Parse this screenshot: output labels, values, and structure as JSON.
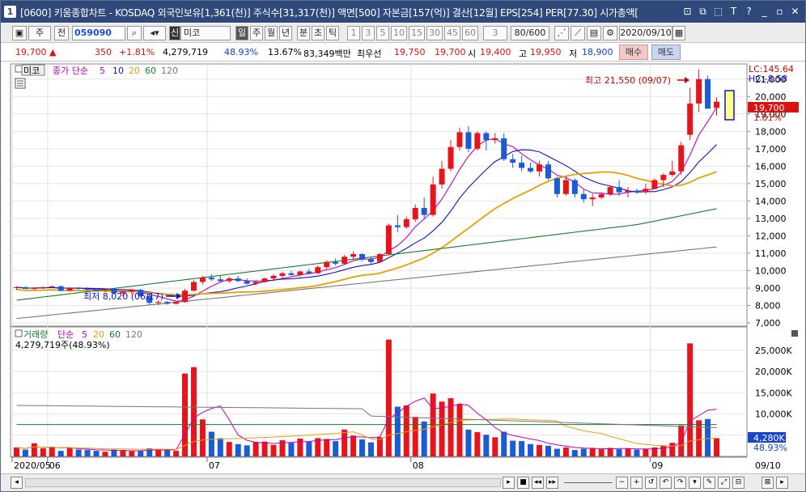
{
  "window": {
    "number": "1",
    "title": "[0600] 키움종합차트 - KOSDAQ 외국인보유[1,361(천)] 주식수[31,317(천)] 액면[500] 자본금[157(억)] 결산[12월] EPS[254] PER[77.30] 시가총액[",
    "buttons": [
      "⊡",
      "⧉",
      "⬚",
      "T",
      "?",
      "_",
      "▫",
      "✕"
    ]
  },
  "toolbar": {
    "period_label": "주",
    "prev_label": "전",
    "code": "059090",
    "new_badge": "신",
    "name": "미코",
    "tabs": [
      "일",
      "주",
      "월",
      "년",
      "분",
      "초",
      "틱"
    ],
    "intervals": [
      "1",
      "3",
      "5",
      "10",
      "15",
      "30",
      "45",
      "60"
    ],
    "custom": "3",
    "count": "80/600",
    "date": "2020/09/10"
  },
  "price": {
    "current": "19,700 ▲",
    "change": "350",
    "change_pct": "+1.81%",
    "volume": "4,279,719",
    "vol_ratio": "48.93%",
    "turnover": "13.67%",
    "amount": "83,349백만",
    "best_ask_label": "최우선",
    "best_ask": "19,750",
    "best_bid": "19,700",
    "open_label": "시",
    "open": "19,400",
    "high_label": "고",
    "high": "19,950",
    "low_label": "저",
    "low": "18,900",
    "buy": "매수",
    "sell": "매도"
  },
  "price_panel": {
    "name_tag": "미코",
    "legend_title": "종가 단순",
    "ma_labels": [
      "5",
      "10",
      "20",
      "60",
      "120"
    ],
    "ma_colors": [
      "#c000c0",
      "#1010d0",
      "#e8a000",
      "#1a7a2a",
      "#777777"
    ],
    "lc": "LC:145.64",
    "hc": "HC:-8.58",
    "current_tag": "19,700",
    "pct_tag": "1.81%",
    "high_note": "최고 21,550 (09/07)",
    "low_note": "최저 8,020 (06/17)",
    "y_labels": [
      "21,000",
      "20,000",
      "19,000",
      "18,000",
      "17,000",
      "16,000",
      "15,000",
      "14,000",
      "13,000",
      "12,000",
      "11,000",
      "10,000",
      "9,000",
      "8,000",
      "7,000"
    ]
  },
  "volume_panel": {
    "legend_title": "거래량",
    "legend_ma": "단순",
    "ma_labels": [
      "5",
      "20",
      "60",
      "120"
    ],
    "info": "4,279,719주(48.93%)",
    "y_labels": [
      "25,000K",
      "20,000K",
      "15,000K",
      "10,000K",
      "5,000K"
    ],
    "current_tag": "4,280K",
    "pct_tag": "48.93%"
  },
  "x_axis": {
    "labels": [
      "2020/05",
      "06",
      "07",
      "08",
      "09"
    ],
    "end_label": "09/10"
  },
  "chart_data": {
    "type": "candlestick",
    "ohlc": [
      [
        9000,
        9100,
        8900,
        9050
      ],
      [
        9050,
        9100,
        8950,
        8950
      ],
      [
        8950,
        9050,
        8900,
        9000
      ],
      [
        9000,
        9100,
        8950,
        9050
      ],
      [
        9050,
        9150,
        9000,
        9100
      ],
      [
        9100,
        9150,
        8800,
        8850
      ],
      [
        8850,
        9050,
        8800,
        9000
      ],
      [
        9000,
        9050,
        8900,
        8950
      ],
      [
        8950,
        9050,
        8850,
        8900
      ],
      [
        8900,
        9000,
        8800,
        8850
      ],
      [
        8850,
        8950,
        8750,
        8900
      ],
      [
        8900,
        8950,
        8650,
        8700
      ],
      [
        8700,
        8800,
        8550,
        8800
      ],
      [
        8800,
        8950,
        8650,
        8900
      ],
      [
        8900,
        8950,
        8500,
        8550
      ],
      [
        8550,
        8700,
        8050,
        8150
      ],
      [
        8150,
        8300,
        8020,
        8200
      ],
      [
        8200,
        8250,
        8050,
        8100
      ],
      [
        8100,
        8250,
        8050,
        8200
      ],
      [
        8200,
        8950,
        8150,
        8850
      ],
      [
        8850,
        9450,
        8800,
        9350
      ],
      [
        9350,
        9700,
        9200,
        9600
      ],
      [
        9600,
        9800,
        9400,
        9500
      ],
      [
        9500,
        9700,
        9300,
        9400
      ],
      [
        9400,
        9650,
        9300,
        9550
      ],
      [
        9550,
        9700,
        9350,
        9400
      ],
      [
        9400,
        9550,
        9200,
        9250
      ],
      [
        9250,
        9450,
        9150,
        9350
      ],
      [
        9350,
        9600,
        9300,
        9550
      ],
      [
        9550,
        9800,
        9400,
        9700
      ],
      [
        9700,
        9950,
        9550,
        9850
      ],
      [
        9850,
        10000,
        9700,
        9750
      ],
      [
        9750,
        10000,
        9650,
        9950
      ],
      [
        9950,
        10100,
        9800,
        9850
      ],
      [
        9850,
        10300,
        9800,
        10200
      ],
      [
        10200,
        10600,
        10100,
        10500
      ],
      [
        10500,
        10700,
        10300,
        10400
      ],
      [
        10400,
        10900,
        10350,
        10800
      ],
      [
        10800,
        11100,
        10650,
        10950
      ],
      [
        10950,
        11000,
        10550,
        10650
      ],
      [
        10650,
        10800,
        10400,
        10500
      ],
      [
        10500,
        11000,
        10450,
        10950
      ],
      [
        10950,
        12700,
        10900,
        12600
      ],
      [
        12600,
        13200,
        12200,
        12500
      ],
      [
        12500,
        13100,
        12400,
        12950
      ],
      [
        12950,
        13800,
        12800,
        13600
      ],
      [
        13600,
        14200,
        13000,
        13200
      ],
      [
        13200,
        15400,
        13100,
        14950
      ],
      [
        14950,
        16300,
        14700,
        15850
      ],
      [
        15850,
        17500,
        15700,
        17100
      ],
      [
        17100,
        18200,
        16900,
        17950
      ],
      [
        17950,
        18300,
        16800,
        17000
      ],
      [
        17000,
        18000,
        16900,
        17900
      ],
      [
        17900,
        18000,
        16900,
        17500
      ],
      [
        17500,
        17900,
        17300,
        17600
      ],
      [
        17600,
        17900,
        16300,
        16400
      ],
      [
        16400,
        16700,
        15900,
        16200
      ],
      [
        16200,
        16600,
        15700,
        15900
      ],
      [
        15900,
        16200,
        15600,
        15700
      ],
      [
        15700,
        16300,
        15400,
        16100
      ],
      [
        16100,
        16300,
        15200,
        15300
      ],
      [
        15300,
        15400,
        14200,
        14400
      ],
      [
        14400,
        15400,
        14300,
        15200
      ],
      [
        15200,
        15300,
        14200,
        14400
      ],
      [
        14400,
        14700,
        13900,
        14100
      ],
      [
        14100,
        14400,
        13700,
        14200
      ],
      [
        14200,
        14500,
        14100,
        14400
      ],
      [
        14400,
        14900,
        14300,
        14800
      ],
      [
        14800,
        15200,
        14300,
        14500
      ],
      [
        14500,
        14800,
        14200,
        14600
      ],
      [
        14600,
        14700,
        14400,
        14500
      ],
      [
        14500,
        15000,
        14400,
        14700
      ],
      [
        14700,
        15300,
        14700,
        15200
      ],
      [
        15200,
        15600,
        14800,
        15500
      ],
      [
        15500,
        16300,
        15400,
        15700
      ],
      [
        15700,
        17400,
        15500,
        17200
      ],
      [
        17800,
        20500,
        17500,
        19600
      ],
      [
        19600,
        21550,
        19100,
        21000
      ],
      [
        21000,
        21200,
        19400,
        19300
      ],
      [
        19350,
        19950,
        18900,
        19700
      ]
    ],
    "volume_k": [
      2100,
      1600,
      3100,
      1900,
      2200,
      1300,
      2000,
      1600,
      1500,
      1300,
      1100,
      1600,
      1500,
      1200,
      1300,
      1900,
      1700,
      1500,
      1300,
      19500,
      21000,
      8700,
      5800,
      4300,
      3400,
      2900,
      2600,
      3400,
      3500,
      2700,
      3800,
      3200,
      4200,
      3500,
      4300,
      4100,
      3600,
      6300,
      4900,
      4000,
      3300,
      4500,
      27500,
      11700,
      12000,
      9300,
      8200,
      14800,
      12900,
      13700,
      12300,
      6300,
      5700,
      5100,
      4500,
      5800,
      3700,
      3600,
      2900,
      2700,
      2500,
      1800,
      2100,
      1500,
      1800,
      2000,
      1700,
      2000,
      1700,
      1900,
      1600,
      1700,
      2100,
      2500,
      3200,
      7300,
      26600,
      8500,
      8800,
      4280
    ],
    "ma5": [],
    "ylim": [
      7000,
      21500
    ],
    "vol_ylim": [
      0,
      28000
    ]
  }
}
